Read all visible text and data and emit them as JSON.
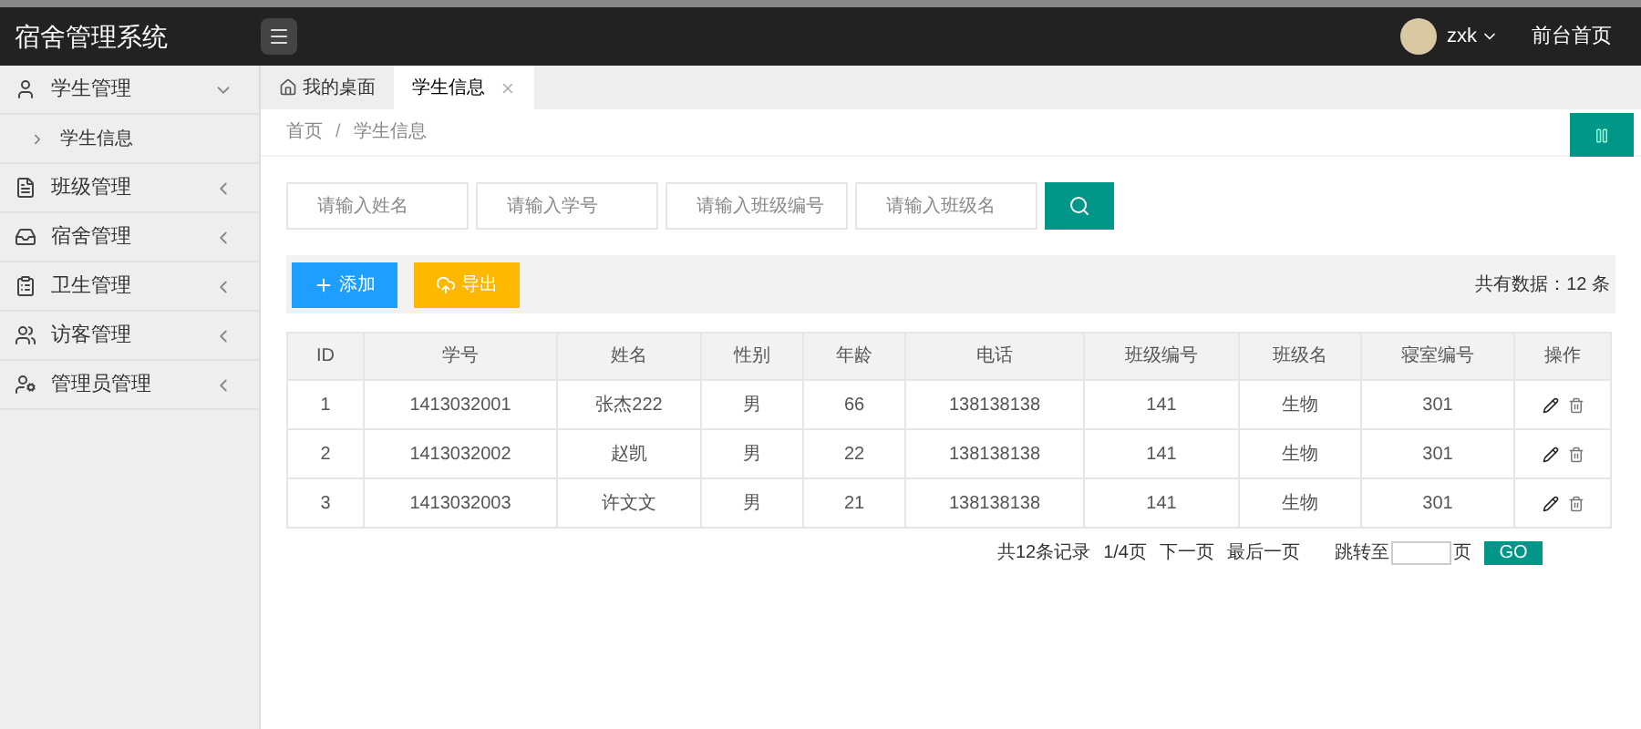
{
  "header": {
    "title": "宿舍管理系统",
    "user": "zxk",
    "home_link": "前台首页"
  },
  "sidebar": {
    "items": [
      {
        "label": "学生管理",
        "expanded": true,
        "children": [
          {
            "label": "学生信息"
          }
        ]
      },
      {
        "label": "班级管理",
        "expanded": false
      },
      {
        "label": "宿舍管理",
        "expanded": false
      },
      {
        "label": "卫生管理",
        "expanded": false
      },
      {
        "label": "访客管理",
        "expanded": false
      },
      {
        "label": "管理员管理",
        "expanded": false
      }
    ]
  },
  "tabs": [
    {
      "label": "我的桌面",
      "selected": false,
      "closable": false
    },
    {
      "label": "学生信息",
      "selected": true,
      "closable": true
    }
  ],
  "breadcrumb": {
    "items": [
      "首页",
      "学生信息"
    ],
    "separator": "/"
  },
  "search": {
    "fields": [
      {
        "placeholder": "请输入姓名"
      },
      {
        "placeholder": "请输入学号"
      },
      {
        "placeholder": "请输入班级编号"
      },
      {
        "placeholder": "请输入班级名"
      }
    ]
  },
  "toolbar": {
    "add": "添加",
    "export": "导出",
    "total": "共有数据：12 条"
  },
  "table": {
    "columns": [
      "ID",
      "学号",
      "姓名",
      "性别",
      "年龄",
      "电话",
      "班级编号",
      "班级名",
      "寝室编号",
      "操作"
    ],
    "rows": [
      [
        "1",
        "1413032001",
        "张杰222",
        "男",
        "66",
        "138138138",
        "141",
        "生物",
        "301"
      ],
      [
        "2",
        "1413032002",
        "赵凯",
        "男",
        "22",
        "138138138",
        "141",
        "生物",
        "301"
      ],
      [
        "3",
        "1413032003",
        "许文文",
        "男",
        "21",
        "138138138",
        "141",
        "生物",
        "301"
      ]
    ]
  },
  "pagination": {
    "records": "共12条记录",
    "pages": "1/4页",
    "next": "下一页",
    "last": "最后一页",
    "jump": "跳转至",
    "page_unit": "页",
    "go": "GO"
  }
}
